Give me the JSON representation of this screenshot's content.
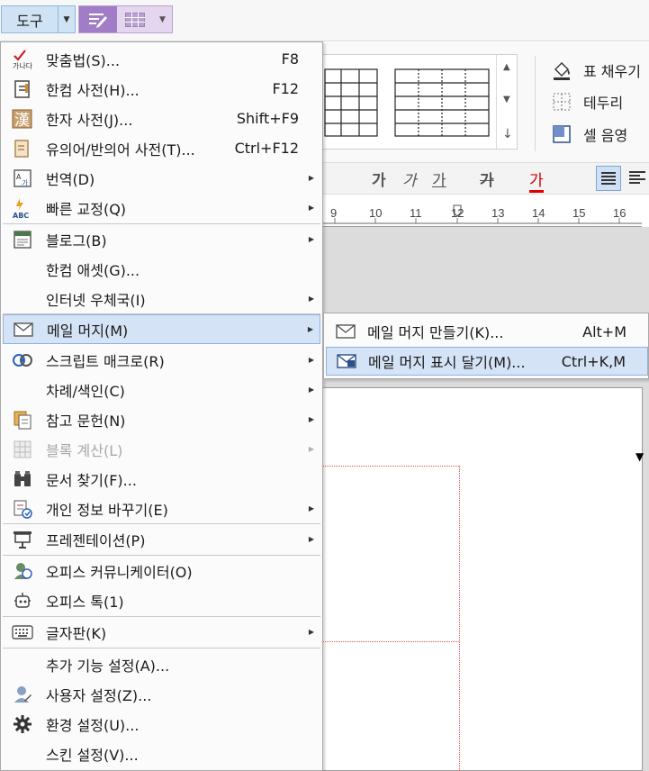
{
  "toolbar": {
    "tools_label": "도구",
    "accent": "#cfe3f4"
  },
  "ribbon": {
    "table_fill": "표 채우기",
    "border": "테두리",
    "cell_shade": "셀 음영",
    "format_glyphs": [
      "가",
      "가",
      "가",
      "가",
      "가"
    ]
  },
  "ruler": {
    "numbers": [
      "9",
      "10",
      "11",
      "12",
      "13",
      "14",
      "15",
      "16"
    ]
  },
  "menu": {
    "items": [
      {
        "label": "맞춤법(S)...",
        "shortcut": "F8",
        "icon": "spellcheck-icon"
      },
      {
        "label": "한컴 사전(H)...",
        "shortcut": "F12",
        "icon": "dictionary-icon"
      },
      {
        "label": "한자 사전(J)...",
        "shortcut": "Shift+F9",
        "icon": "hanja-dictionary-icon"
      },
      {
        "label": "유의어/반의어 사전(T)...",
        "shortcut": "Ctrl+F12",
        "icon": "thesaurus-icon"
      },
      {
        "label": "번역(D)",
        "icon": "translate-icon"
      },
      {
        "label": "빠른 교정(Q)",
        "icon": "quick-correct-icon"
      },
      {
        "label": "블로그(B)",
        "icon": "blog-icon"
      },
      {
        "label": "한컴 애셋(G)...",
        "icon": ""
      },
      {
        "label": "인터넷 우체국(I)",
        "icon": ""
      },
      {
        "label": "메일 머지(M)",
        "icon": "mail-icon"
      },
      {
        "label": "스크립트 매크로(R)",
        "icon": "macro-icon"
      },
      {
        "label": "차례/색인(C)",
        "icon": ""
      },
      {
        "label": "참고 문헌(N)",
        "icon": "bibliography-icon"
      },
      {
        "label": "블록 계산(L)",
        "icon": "block-calc-icon"
      },
      {
        "label": "문서 찾기(F)...",
        "icon": "binoculars-icon"
      },
      {
        "label": "개인 정보 바꾸기(E)",
        "icon": "personal-info-icon"
      },
      {
        "label": "프레젠테이션(P)",
        "icon": "presentation-icon"
      },
      {
        "label": "오피스 커뮤니케이터(O)",
        "icon": "communicator-icon"
      },
      {
        "label": "오피스 톡(1)",
        "icon": "robot-icon"
      },
      {
        "label": "글자판(K)",
        "icon": "keyboard-icon"
      },
      {
        "label": "추가 기능 설정(A)...",
        "icon": ""
      },
      {
        "label": "사용자 설정(Z)...",
        "icon": "user-settings-icon"
      },
      {
        "label": "환경 설정(U)...",
        "icon": "gear-icon"
      },
      {
        "label": "스킨 설정(V)...",
        "icon": ""
      }
    ]
  },
  "submenu": {
    "items": [
      {
        "label": "메일 머지 만들기(K)...",
        "shortcut": "Alt+M"
      },
      {
        "label": "메일 머지 표시 달기(M)...",
        "shortcut": "Ctrl+K,M"
      }
    ]
  }
}
